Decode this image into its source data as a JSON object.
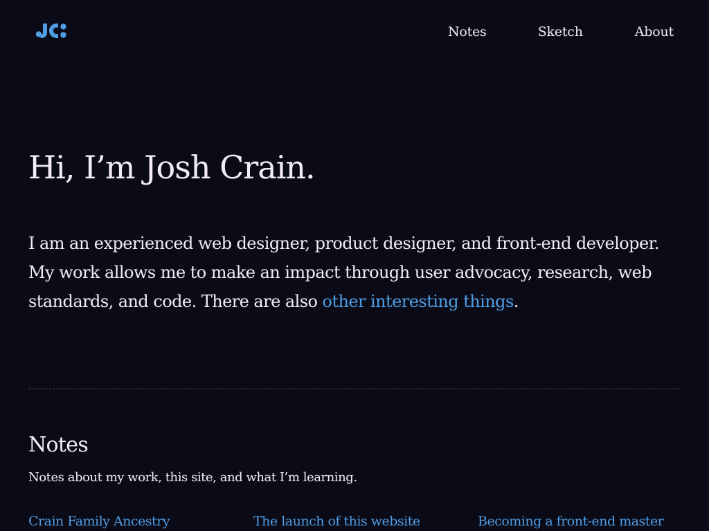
{
  "header": {
    "logo_icon": "jc-logo-icon",
    "nav": [
      {
        "label": "Notes"
      },
      {
        "label": "Sketch"
      },
      {
        "label": "About"
      }
    ]
  },
  "hero": {
    "title": "Hi, I’m Josh Crain.",
    "intro_text": "I am an experienced web designer, product designer, and front-end developer. My work allows me to make an impact through user advocacy, research, web standards, and code. There are also ",
    "link_text": "other interesting things",
    "after_link": "."
  },
  "notes": {
    "title": "Notes",
    "description": "Notes about my work, this site, and what I’m learning.",
    "items": [
      {
        "title": "Crain Family Ancestry"
      },
      {
        "title": "The launch of this website"
      },
      {
        "title": "Becoming a front-end master"
      }
    ]
  },
  "colors": {
    "background": "#0b0b18",
    "text": "#f3ecf7",
    "accent": "#4f9de3",
    "divider": "#4a4a5d"
  }
}
